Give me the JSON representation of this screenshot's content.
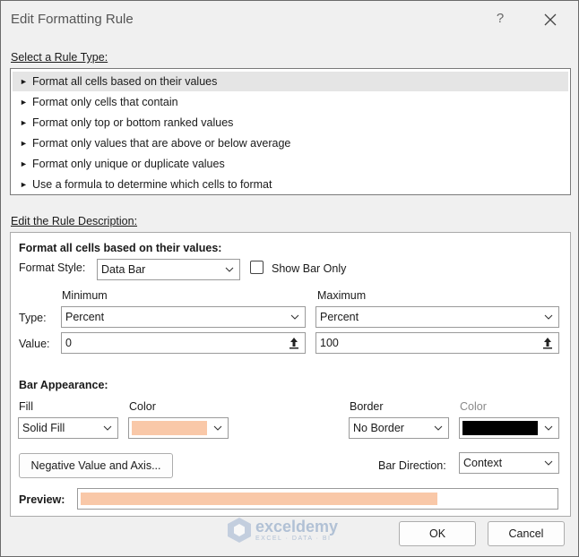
{
  "window": {
    "title": "Edit Formatting Rule",
    "help": "?"
  },
  "rule_type": {
    "heading": "Select a Rule Type:",
    "items": [
      "Format all cells based on their values",
      "Format only cells that contain",
      "Format only top or bottom ranked values",
      "Format only values that are above or below average",
      "Format only unique or duplicate values",
      "Use a formula to determine which cells to format"
    ],
    "selected_index": 0
  },
  "description": {
    "heading": "Edit the Rule Description:",
    "section_title": "Format all cells based on their values:",
    "format_style_label": "Format Style:",
    "format_style_value": "Data Bar",
    "show_bar_only_label": "Show Bar Only",
    "show_bar_only_checked": false,
    "minimum_label": "Minimum",
    "maximum_label": "Maximum",
    "type_label": "Type:",
    "value_label": "Value:",
    "min_type": "Percent",
    "max_type": "Percent",
    "min_value": "0",
    "max_value": "100"
  },
  "bar_appearance": {
    "heading": "Bar Appearance:",
    "fill_label": "Fill",
    "fill_value": "Solid Fill",
    "color_label": "Color",
    "fill_color": "#f9c8a8",
    "border_label": "Border",
    "border_value": "No Border",
    "border_color_label": "Color",
    "border_color": "#000000",
    "negative_button": "Negative Value and Axis...",
    "bar_direction_label": "Bar Direction:",
    "bar_direction_value": "Context",
    "preview_label": "Preview:"
  },
  "buttons": {
    "ok": "OK",
    "cancel": "Cancel"
  },
  "watermark": {
    "name": "exceldemy",
    "tagline": "EXCEL · DATA · BI"
  }
}
